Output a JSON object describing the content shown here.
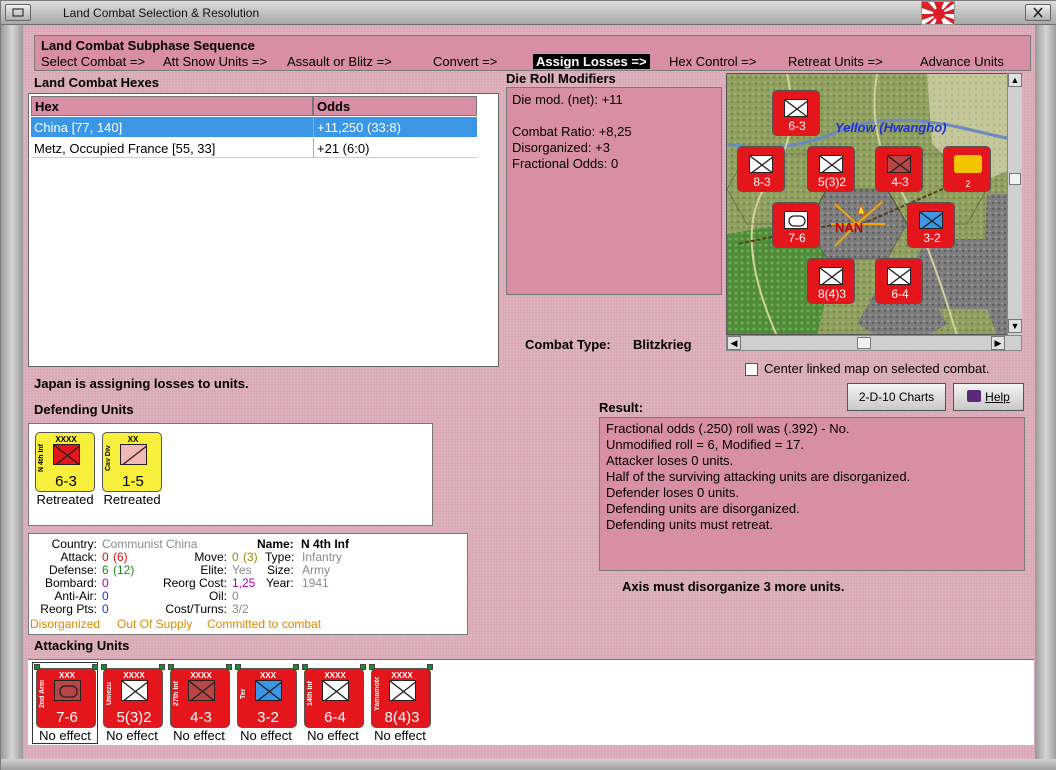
{
  "window": {
    "title": "Land Combat Selection & Resolution"
  },
  "subphase": {
    "title": "Land Combat Subphase Sequence",
    "steps": [
      {
        "label": "Select Combat =>"
      },
      {
        "label": "Att Snow Units =>"
      },
      {
        "label": "Assault or Blitz =>"
      },
      {
        "label": "Convert =>"
      },
      {
        "label": "Assign Losses =>"
      },
      {
        "label": "Hex Control =>"
      },
      {
        "label": "Retreat Units =>"
      },
      {
        "label": "Advance Units"
      }
    ],
    "active_index": 4
  },
  "hexes": {
    "title": "Land Combat Hexes",
    "columns": [
      "Hex",
      "Odds"
    ],
    "rows": [
      {
        "hex": "China [77, 140]",
        "odds": "+11,250 (33:8)"
      },
      {
        "hex": "Metz, Occupied France [55, 33]",
        "odds": "+21 (6:0)"
      }
    ]
  },
  "die_roll": {
    "title": "Die Roll Modifiers",
    "lines": [
      "Die mod. (net): +11",
      "Combat Ratio: +8,25",
      "Disorganized: +3",
      "Fractional Odds: 0"
    ]
  },
  "combat_type": {
    "label": "Combat Type:",
    "value": "Blitzkrieg"
  },
  "map": {
    "river_label": "Yellow (Hwangho)",
    "city_label": "NAN",
    "center_label": "Center linked map on selected combat."
  },
  "status": "Japan is assigning losses to units.",
  "buttons": {
    "charts": "2-D-10 Charts",
    "help": "Help"
  },
  "defending": {
    "title": "Defending Units",
    "units": [
      {
        "size": "XXXX",
        "name": "N 4th Inf",
        "strength": "6-3",
        "status": "Retreated",
        "color": "#e4161b",
        "symbol": "infantry"
      },
      {
        "size": "XX",
        "name": "Cav Div",
        "strength": "1-5",
        "status": "Retreated",
        "color": "#f7ef3c",
        "symbol": "cavalry"
      }
    ]
  },
  "info": {
    "country_label": "Country:",
    "country": "Communist China",
    "name_label": "Name:",
    "name": "N 4th Inf",
    "attack_label": "Attack:",
    "attack": "0",
    "attack_paren": "(6)",
    "move_label": "Move:",
    "move": "0",
    "move_paren": "(3)",
    "type_label": "Type:",
    "type": "Infantry",
    "defense_label": "Defense:",
    "defense": "6",
    "defense_paren": "(12)",
    "elite_label": "Elite:",
    "elite": "Yes",
    "size_label": "Size:",
    "size": "Army",
    "bombard_label": "Bombard:",
    "bombard": "0",
    "reorg_cost_label": "Reorg Cost:",
    "reorg_cost": "1,25",
    "year_label": "Year:",
    "year": "1941",
    "antiair_label": "Anti-Air:",
    "antiair": "0",
    "oil_label": "Oil:",
    "oil": "0",
    "reorg_pts_label": "Reorg Pts:",
    "reorg_pts": "0",
    "cost_turns_label": "Cost/Turns:",
    "cost_turns": "3/2",
    "status1": "Disorganized",
    "status2": "Out Of Supply",
    "status3": "Committed to combat"
  },
  "result": {
    "title": "Result:",
    "lines": [
      "Fractional odds (.250) roll was (.392)  - No.",
      "Unmodified roll = 6, Modified = 17.",
      "Attacker loses 0 units.",
      "Half of the surviving attacking units are disorganized.",
      "Defender loses 0 units.",
      "Defending units are disorganized.",
      "Defending units must retreat."
    ],
    "footer": "Axis must disorganize 3 more units."
  },
  "attacking": {
    "title": "Attacking Units",
    "units": [
      {
        "size": "XXX",
        "name": "2nd Arm",
        "strength": "7-6",
        "status": "No effect",
        "symbol": "armor"
      },
      {
        "size": "XXXX",
        "name": "Umezu",
        "strength": "5(3)2",
        "status": "No effect",
        "symbol": "infantry"
      },
      {
        "size": "XXXX",
        "name": "27th Inf",
        "strength": "4-3",
        "status": "No effect",
        "symbol": "infantry-dis"
      },
      {
        "size": "XXX",
        "name": "Ter",
        "strength": "3-2",
        "status": "No effect",
        "symbol": "marine"
      },
      {
        "size": "XXXX",
        "name": "14th Inf",
        "strength": "6-4",
        "status": "No effect",
        "symbol": "infantry"
      },
      {
        "size": "XXXX",
        "name": "Yamamoto",
        "strength": "8(4)3",
        "status": "No effect",
        "symbol": "infantry"
      }
    ]
  },
  "colors": {
    "panel_pink": "#d88ea4",
    "selection_blue": "#3c96e6",
    "unit_red": "#e4161b",
    "unit_yellow": "#f7ef3c",
    "gray_value": "#8a8a8a",
    "red_value": "#d11",
    "green_value": "#1a8a1a",
    "magenta_value": "#b000b0",
    "orange_status": "#d98a00"
  },
  "icons": [
    "restore-icon",
    "japan-flag-icon",
    "close-icon",
    "help-book-icon",
    "checkbox-icon"
  ]
}
